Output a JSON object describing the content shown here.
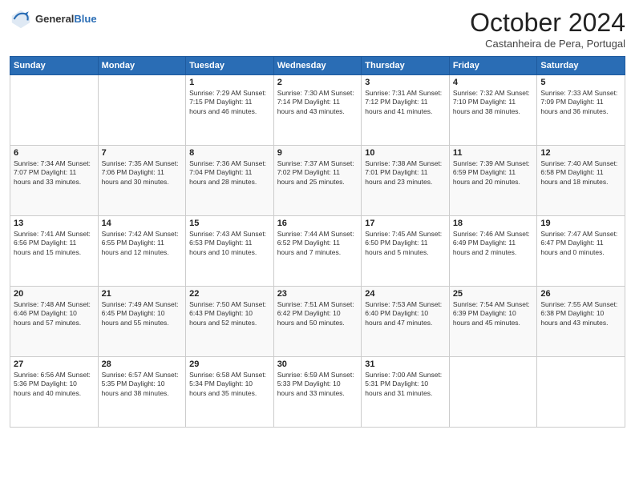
{
  "header": {
    "logo_general": "General",
    "logo_blue": "Blue",
    "month": "October 2024",
    "location": "Castanheira de Pera, Portugal"
  },
  "days_of_week": [
    "Sunday",
    "Monday",
    "Tuesday",
    "Wednesday",
    "Thursday",
    "Friday",
    "Saturday"
  ],
  "weeks": [
    [
      {
        "day": "",
        "info": ""
      },
      {
        "day": "",
        "info": ""
      },
      {
        "day": "1",
        "info": "Sunrise: 7:29 AM\nSunset: 7:15 PM\nDaylight: 11 hours and 46 minutes."
      },
      {
        "day": "2",
        "info": "Sunrise: 7:30 AM\nSunset: 7:14 PM\nDaylight: 11 hours and 43 minutes."
      },
      {
        "day": "3",
        "info": "Sunrise: 7:31 AM\nSunset: 7:12 PM\nDaylight: 11 hours and 41 minutes."
      },
      {
        "day": "4",
        "info": "Sunrise: 7:32 AM\nSunset: 7:10 PM\nDaylight: 11 hours and 38 minutes."
      },
      {
        "day": "5",
        "info": "Sunrise: 7:33 AM\nSunset: 7:09 PM\nDaylight: 11 hours and 36 minutes."
      }
    ],
    [
      {
        "day": "6",
        "info": "Sunrise: 7:34 AM\nSunset: 7:07 PM\nDaylight: 11 hours and 33 minutes."
      },
      {
        "day": "7",
        "info": "Sunrise: 7:35 AM\nSunset: 7:06 PM\nDaylight: 11 hours and 30 minutes."
      },
      {
        "day": "8",
        "info": "Sunrise: 7:36 AM\nSunset: 7:04 PM\nDaylight: 11 hours and 28 minutes."
      },
      {
        "day": "9",
        "info": "Sunrise: 7:37 AM\nSunset: 7:02 PM\nDaylight: 11 hours and 25 minutes."
      },
      {
        "day": "10",
        "info": "Sunrise: 7:38 AM\nSunset: 7:01 PM\nDaylight: 11 hours and 23 minutes."
      },
      {
        "day": "11",
        "info": "Sunrise: 7:39 AM\nSunset: 6:59 PM\nDaylight: 11 hours and 20 minutes."
      },
      {
        "day": "12",
        "info": "Sunrise: 7:40 AM\nSunset: 6:58 PM\nDaylight: 11 hours and 18 minutes."
      }
    ],
    [
      {
        "day": "13",
        "info": "Sunrise: 7:41 AM\nSunset: 6:56 PM\nDaylight: 11 hours and 15 minutes."
      },
      {
        "day": "14",
        "info": "Sunrise: 7:42 AM\nSunset: 6:55 PM\nDaylight: 11 hours and 12 minutes."
      },
      {
        "day": "15",
        "info": "Sunrise: 7:43 AM\nSunset: 6:53 PM\nDaylight: 11 hours and 10 minutes."
      },
      {
        "day": "16",
        "info": "Sunrise: 7:44 AM\nSunset: 6:52 PM\nDaylight: 11 hours and 7 minutes."
      },
      {
        "day": "17",
        "info": "Sunrise: 7:45 AM\nSunset: 6:50 PM\nDaylight: 11 hours and 5 minutes."
      },
      {
        "day": "18",
        "info": "Sunrise: 7:46 AM\nSunset: 6:49 PM\nDaylight: 11 hours and 2 minutes."
      },
      {
        "day": "19",
        "info": "Sunrise: 7:47 AM\nSunset: 6:47 PM\nDaylight: 11 hours and 0 minutes."
      }
    ],
    [
      {
        "day": "20",
        "info": "Sunrise: 7:48 AM\nSunset: 6:46 PM\nDaylight: 10 hours and 57 minutes."
      },
      {
        "day": "21",
        "info": "Sunrise: 7:49 AM\nSunset: 6:45 PM\nDaylight: 10 hours and 55 minutes."
      },
      {
        "day": "22",
        "info": "Sunrise: 7:50 AM\nSunset: 6:43 PM\nDaylight: 10 hours and 52 minutes."
      },
      {
        "day": "23",
        "info": "Sunrise: 7:51 AM\nSunset: 6:42 PM\nDaylight: 10 hours and 50 minutes."
      },
      {
        "day": "24",
        "info": "Sunrise: 7:53 AM\nSunset: 6:40 PM\nDaylight: 10 hours and 47 minutes."
      },
      {
        "day": "25",
        "info": "Sunrise: 7:54 AM\nSunset: 6:39 PM\nDaylight: 10 hours and 45 minutes."
      },
      {
        "day": "26",
        "info": "Sunrise: 7:55 AM\nSunset: 6:38 PM\nDaylight: 10 hours and 43 minutes."
      }
    ],
    [
      {
        "day": "27",
        "info": "Sunrise: 6:56 AM\nSunset: 5:36 PM\nDaylight: 10 hours and 40 minutes."
      },
      {
        "day": "28",
        "info": "Sunrise: 6:57 AM\nSunset: 5:35 PM\nDaylight: 10 hours and 38 minutes."
      },
      {
        "day": "29",
        "info": "Sunrise: 6:58 AM\nSunset: 5:34 PM\nDaylight: 10 hours and 35 minutes."
      },
      {
        "day": "30",
        "info": "Sunrise: 6:59 AM\nSunset: 5:33 PM\nDaylight: 10 hours and 33 minutes."
      },
      {
        "day": "31",
        "info": "Sunrise: 7:00 AM\nSunset: 5:31 PM\nDaylight: 10 hours and 31 minutes."
      },
      {
        "day": "",
        "info": ""
      },
      {
        "day": "",
        "info": ""
      }
    ]
  ]
}
